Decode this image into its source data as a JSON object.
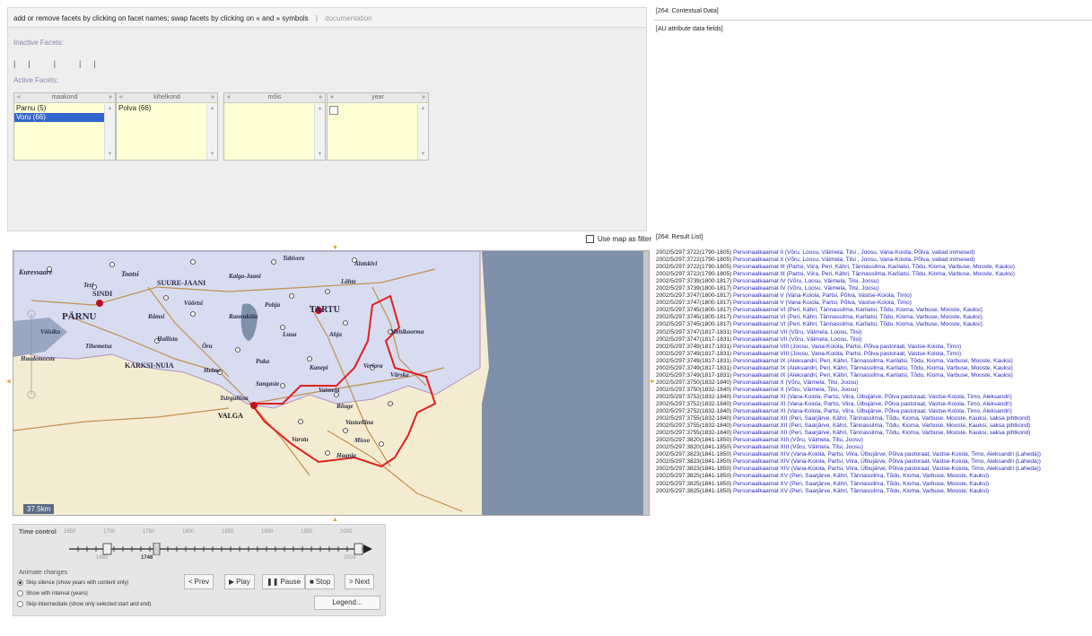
{
  "facet_header": {
    "instructions": "add or remove facets by clicking on facet names; swap facets by clicking on « and » symbols",
    "separator": "|",
    "documentation_link": "documentation"
  },
  "inactive_facets_label": "Inactive Facets:",
  "active_facets_label": "Active Facets:",
  "inactive_bars": "| | | | |",
  "facets": [
    {
      "name": "maakond",
      "left_arrow": "«",
      "right_arrow": "»",
      "items": [
        "Parnu (5)",
        "Voru (66)"
      ],
      "selected_index": 1
    },
    {
      "name": "kihelkond",
      "left_arrow": "«",
      "right_arrow": "»",
      "items": [
        "Polva (66)"
      ],
      "selected_index": -1
    },
    {
      "name": "mõis",
      "left_arrow": "«",
      "right_arrow": "»",
      "items": [],
      "selected_index": -1
    },
    {
      "name": "year",
      "left_arrow": "«",
      "right_arrow": "»",
      "items": [],
      "selected_index": -1
    }
  ],
  "map_filter_label": "Use map as filter",
  "map": {
    "scale_label": "37.5km",
    "place_labels": [
      "Kuressaare",
      "Tootsi",
      "SUURE-JAANI",
      "Tabivere",
      "Alatskivi",
      "Teri",
      "SINDI",
      "Vöörtsi",
      "Kalga-Jaani",
      "Lähte",
      "PÄRNU",
      "TARTU",
      "Rämsi",
      "Rannaküla",
      "Pohja",
      "Kavastu",
      "Lutsvile",
      "Vöhma",
      "Mustla",
      "Luua",
      "Ahja",
      "Vöisiku",
      "Tihemetsa",
      "Hallista",
      "Öru",
      "Kaardi",
      "Kambja",
      "Mehikoorma",
      "Haademeeste",
      "KARKSI-NUIA",
      "Helme",
      "Puka",
      "Kanepi",
      "Veriora",
      "Värska",
      "Räpina",
      "Sangaste",
      "Vaimela",
      "Tsirguliina",
      "Koikula",
      "VALGA",
      "Rõuge",
      "Vastseliina",
      "Varstu",
      "Misso",
      "Haanja"
    ],
    "colors": {
      "land": "#d9dff0",
      "water": "#7f90aa",
      "border": "#e02020",
      "roads": "#c09050"
    }
  },
  "time_control": {
    "title": "Time control",
    "tick_years": [
      "1650",
      "1700",
      "1750",
      "1800",
      "1850",
      "1900",
      "1950",
      "2000"
    ],
    "start_year": "1683",
    "current_year": "1746",
    "end_year": "2003",
    "animate_title": "Animate changes",
    "options": [
      {
        "label": "Skip silence (show years with content only)",
        "selected": true
      },
      {
        "label": "Show with interval (years)",
        "selected": false
      },
      {
        "label": "Skip intermediate (show only selected start and end)",
        "selected": false
      }
    ],
    "buttons": {
      "prev": "Prev",
      "play": "Play",
      "pause": "Pause",
      "stop": "Stop",
      "next": "Next",
      "legend": "Legend..."
    }
  },
  "context": {
    "title": "[264: Contextual Data]",
    "subtitle": "[AU attribute data fields]"
  },
  "result_list": {
    "title": "[264: Result List]",
    "rows": [
      {
        "id": "2002/5/297:3722",
        "period": "(1790-1805)",
        "text": "Personaalkaamat II (Võru, Loosu, Väimela, Tilsi , Joosu, Vana-Koiola, Põlva, vabad inimesed)"
      },
      {
        "id": "2002/5/297:3722",
        "period": "(1790-1805)",
        "text": "Personaalkaamat II (Võru, Loosu, Väimela, Tilsi , Joosu, Vana-Koiola, Põlva, vabad inimesed)"
      },
      {
        "id": "2002/5/297:3722",
        "period": "(1790-1805)",
        "text": "Personaalkaamat III (Partsi, Viira, Peri, Kähri, Tännassilma, Karilatsi, Tõdu, Kioma, Varbuse, Mooste, Kauksi)"
      },
      {
        "id": "2002/5/297:3722",
        "period": "(1790-1805)",
        "text": "Personaalkaamat III (Partsi, Viira, Peri, Kähri, Tännassilma, Karilatsi, Tõdu, Kioma, Varbuse, Mooste, Kauksi)"
      },
      {
        "id": "2002/5/297:3739",
        "period": "(1800-1817)",
        "text": "Personaalkaamat IV (Võru, Loosu, Väimela, Tilsi, Joosu)"
      },
      {
        "id": "2002/5/297:3739",
        "period": "(1800-1817)",
        "text": "Personaalkaamat IV (Võru, Loosu, Väimela, Tilsi, Joosu)"
      },
      {
        "id": "2002/5/297:3747",
        "period": "(1800-1817)",
        "text": "Personaalkaamat V (Vana-Koiola, Partsi, Põlva, Vastse-Koiola, Timo)"
      },
      {
        "id": "2002/5/297:3747",
        "period": "(1800-1817)",
        "text": "Personaalkaamat V (Vana-Koiola, Partsi, Põlva, Vastse-Koiola, Timo)"
      },
      {
        "id": "2002/5/297:3745",
        "period": "(1800-1817)",
        "text": "Personaalkaamat VI (Peri, Kähri, Tännassilma, Karilatsi, Tõdu, Kioma, Varbuse, Mooste, Kauksi)"
      },
      {
        "id": "2002/5/297:3745",
        "period": "(1800-1817)",
        "text": "Personaalkaamat VI (Peri, Kähri, Tännassilma, Karilatsi, Tõdu, Kioma, Varbuse, Mooste, Kauksi)"
      },
      {
        "id": "2002/5/297:3745",
        "period": "(1800-1817)",
        "text": "Personaalkaamat VI (Peri, Kähri, Tännassilma, Karilatsi, Tõdu, Kioma, Varbuse, Mooste, Kauksi)"
      },
      {
        "id": "2002/5/297:3747",
        "period": "(1817-1831)",
        "text": "Personaalkaamat VII (Võru, Väimela, Loosu, Tilsi)"
      },
      {
        "id": "2002/5/297:3747",
        "period": "(1817-1831)",
        "text": "Personaalkaamat VII (Võru, Väimela, Loosu, Tilsi)"
      },
      {
        "id": "2002/5/297:3749",
        "period": "(1817-1831)",
        "text": "Personaalkaamat VIII (Joosu, Vana-Koiola, Partsi, Põlva pastoraat, Vastse-Koiola, Timo)"
      },
      {
        "id": "2002/5/297:3749",
        "period": "(1817-1831)",
        "text": "Personaalkaamat VIII (Joosu, Vana-Koiola, Partsi, Põlva pastoraat, Vastse-Koiola, Timo)"
      },
      {
        "id": "2002/5/297:3749",
        "period": "(1817-1831)",
        "text": "Personaalkaamat IX (Aleksandri, Peri, Kähri, Tännassilma, Karilatsi, Tõdu, Kioma, Varbuse, Mooste, Kauksi)"
      },
      {
        "id": "2002/5/297:3749",
        "period": "(1817-1831)",
        "text": "Personaalkaamat IX (Aleksandri, Peri, Kähri, Tännassilma, Karilatsi, Tõdu, Kioma, Varbuse, Mooste, Kauksi)"
      },
      {
        "id": "2002/5/297:3749",
        "period": "(1817-1831)",
        "text": "Personaalkaamat IX (Aleksandri, Peri, Kähri, Tännassilma, Karilatsi, Tõdu, Kioma, Varbuse, Mooste, Kauksi)"
      },
      {
        "id": "2002/5/297:3750",
        "period": "(1832-1840)",
        "text": "Personaalkaamat X (Võru, Väimela, Tilsi, Joosu)"
      },
      {
        "id": "2002/5/297:3750",
        "period": "(1832-1840)",
        "text": "Personaalkaamat X (Võru, Väimela, Tilsi, Joosu)"
      },
      {
        "id": "2002/5/297:3752",
        "period": "(1832-1840)",
        "text": "Personaalkaamat XI (Vana-Koiola, Partsi, Viira, Ülbujärve, Põlva pastoraat, Vastse-Koiola, Timo, Aleksandri)"
      },
      {
        "id": "2002/5/297:3752",
        "period": "(1832-1840)",
        "text": "Personaalkaamat XI (Vana-Koiola, Partsi, Viira, Ülbujärve, Põlva pastoraat, Vastse-Koiola, Timo, Aleksandri)"
      },
      {
        "id": "2002/5/297:3752",
        "period": "(1832-1840)",
        "text": "Personaalkaamat XI (Vana-Koiola, Partsi, Viira, Ülbujärve, Põlva pastoraat, Vastse-Koiola, Timo, Aleksandri)"
      },
      {
        "id": "2002/5/297:3755",
        "period": "(1832-1840)",
        "text": "Personaalkaamat XII (Peri, Saarjärve, Kähri, Tännassilma, Tõdu, Kioma, Varbuse, Mooste, Kauksi, saksa pihtkond)"
      },
      {
        "id": "2002/5/297:3755",
        "period": "(1832-1840)",
        "text": "Personaalkaamat XII (Peri, Saarjärve, Kähri, Tännassilma, Tõdu, Kioma, Varbuse, Mooste, Kauksi, saksa pihtkond)"
      },
      {
        "id": "2002/5/297:3755",
        "period": "(1832-1840)",
        "text": "Personaalkaamat XII (Peri, Saarjärve, Kähri, Tännassilma, Tõdu, Kioma, Varbuse, Mooste, Kauksi, saksa pihtkond)"
      },
      {
        "id": "2002/5/297:3820",
        "period": "(1841-1850)",
        "text": "Personaalkaamat XIII (Võru, Väimela, Tilsi, Joosu)"
      },
      {
        "id": "2002/5/297:3820",
        "period": "(1841-1850)",
        "text": "Personaalkaamat XIII (Võru, Väimela, Tilsi, Joosu)"
      },
      {
        "id": "2002/5/297:3823",
        "period": "(1841-1850)",
        "text": "Personaalkaamat XIV (Vana-Koiola, Partsi, Viira, Ülbujärve, Põlva pastoraat, Vastse-Koiola, Timo, Aleksandri (Laheda))"
      },
      {
        "id": "2002/5/297:3823",
        "period": "(1841-1850)",
        "text": "Personaalkaamat XIV (Vana-Koiola, Partsi, Viira, Ülbujärve, Põlva pastoraat, Vastse-Koiola, Timo, Aleksandri (Laheda))"
      },
      {
        "id": "2002/5/297:3823",
        "period": "(1841-1850)",
        "text": "Personaalkaamat XIV (Vana-Koiola, Partsi, Viira, Ülbujärve, Põlva pastoraat, Vastse-Koiola, Timo, Aleksandri (Laheda))"
      },
      {
        "id": "2002/5/297:3825",
        "period": "(1841-1850)",
        "text": "Personaalkaamat XV (Peri, Saarjärve, Kähri, Tännassilma, Tõdu, Kioma, Varbuse, Mooste, Kauksi)"
      },
      {
        "id": "2002/5/297:3825",
        "period": "(1841-1850)",
        "text": "Personaalkaamat XV (Peri, Saarjärve, Kähri, Tännassilma, Tõdu, Kioma, Varbuse, Mooste, Kauksi)"
      },
      {
        "id": "2002/5/297:3825",
        "period": "(1841-1850)",
        "text": "Personaalkaamat XV (Peri, Saarjärve, Kähri, Tännassilma, Tõdu, Kioma, Varbuse, Mooste, Kauksi)"
      }
    ]
  }
}
